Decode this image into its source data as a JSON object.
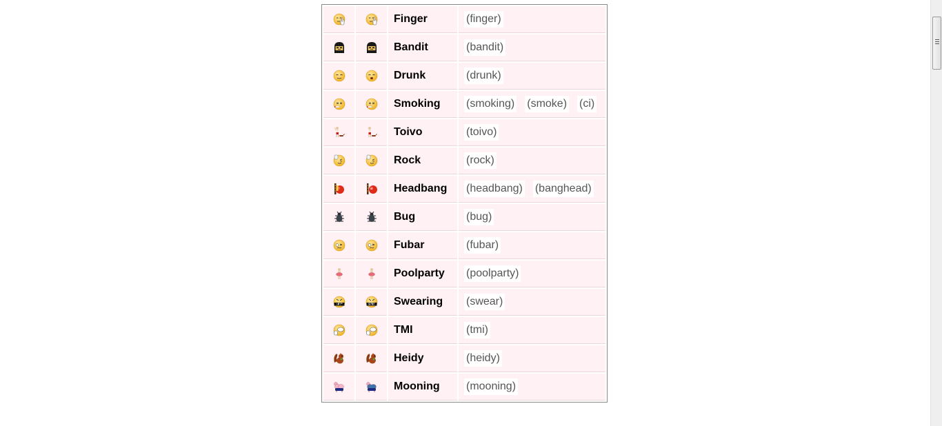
{
  "emoticons": [
    {
      "name": "Finger",
      "icon": "finger-icon",
      "codes": [
        "(finger)"
      ]
    },
    {
      "name": "Bandit",
      "icon": "bandit-icon",
      "codes": [
        "(bandit)"
      ]
    },
    {
      "name": "Drunk",
      "icon": "drunk-icon",
      "codes": [
        "(drunk)"
      ]
    },
    {
      "name": "Smoking",
      "icon": "smoking-icon",
      "codes": [
        "(smoking)",
        "(smoke)",
        "(ci)"
      ]
    },
    {
      "name": "Toivo",
      "icon": "toivo-icon",
      "codes": [
        "(toivo)"
      ]
    },
    {
      "name": "Rock",
      "icon": "rock-icon",
      "codes": [
        "(rock)"
      ]
    },
    {
      "name": "Headbang",
      "icon": "headbang-icon",
      "codes": [
        "(headbang)",
        "(banghead)"
      ]
    },
    {
      "name": "Bug",
      "icon": "bug-icon",
      "codes": [
        "(bug)"
      ]
    },
    {
      "name": "Fubar",
      "icon": "fubar-icon",
      "codes": [
        "(fubar)"
      ]
    },
    {
      "name": "Poolparty",
      "icon": "poolparty-icon",
      "codes": [
        "(poolparty)"
      ]
    },
    {
      "name": "Swearing",
      "icon": "swearing-icon",
      "codes": [
        "(swear)"
      ]
    },
    {
      "name": "TMI",
      "icon": "tmi-icon",
      "codes": [
        "(tmi)"
      ]
    },
    {
      "name": "Heidy",
      "icon": "heidy-icon",
      "codes": [
        "(heidy)"
      ]
    },
    {
      "name": "Mooning",
      "icon": "mooning-icon",
      "codes": [
        "(mooning)"
      ]
    }
  ],
  "colors": {
    "cell_bg": "#fff1f4",
    "code_text": "#555555",
    "face_yellow": "#f7c948"
  }
}
